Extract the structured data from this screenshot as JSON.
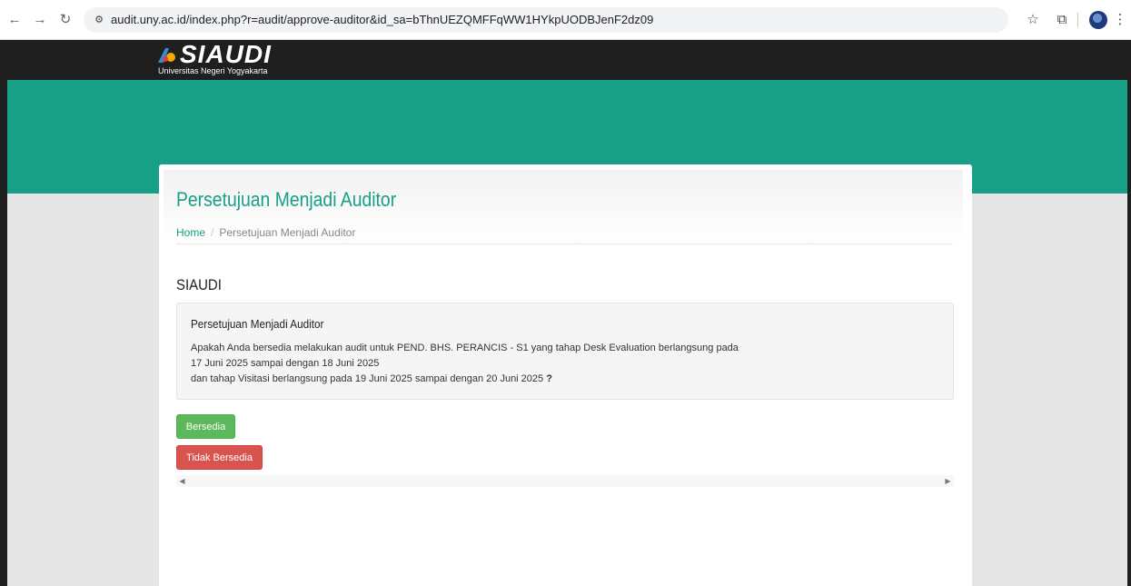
{
  "browser": {
    "back_icon": "←",
    "forward_icon": "→",
    "reload_icon": "↻",
    "site_info_icon": "⚙",
    "url": "audit.uny.ac.id/index.php?r=audit/approve-auditor&id_sa=bThnUEZQMFFqWW1HYkpUODBJenF2dz09",
    "bookmark_icon": "☆",
    "extensions_icon": "⧉",
    "menu_icon": "⋮"
  },
  "site": {
    "logo_text": "SIAUDI",
    "logo_subtitle": "Universitas Negeri Yogyakarta"
  },
  "page": {
    "title": "Persetujuan Menjadi Auditor",
    "breadcrumb": {
      "home": "Home",
      "separator": "/",
      "current": "Persetujuan Menjadi Auditor"
    },
    "section_title": "SIAUDI"
  },
  "well": {
    "title": "Persetujuan Menjadi Auditor",
    "line1": "Apakah Anda bersedia melakukan audit untuk PEND. BHS. PERANCIS - S1 yang tahap Desk Evaluation berlangsung pada",
    "line2": "17 Juni 2025 sampai dengan 18 Juni 2025",
    "line3": "dan tahap Visitasi berlangsung pada 19 Juni 2025 sampai dengan 20 Juni 2025",
    "question_mark": "?"
  },
  "buttons": {
    "accept": "Bersedia",
    "decline": "Tidak Bersedia"
  },
  "scrollbar": {
    "left_arrow": "◀",
    "right_arrow": "▶"
  },
  "colors": {
    "brand_green": "#17a086",
    "success": "#5cb85c",
    "danger": "#d9534f",
    "topbar": "#1f1f1f"
  }
}
